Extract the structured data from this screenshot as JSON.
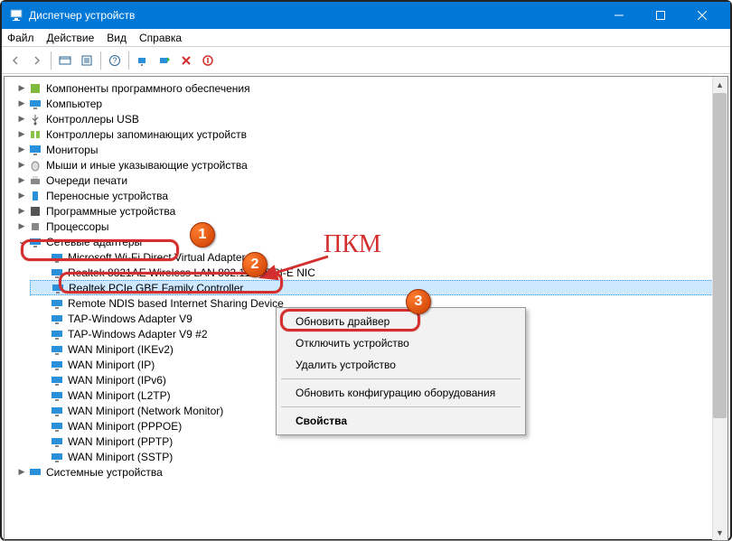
{
  "window": {
    "title": "Диспетчер устройств"
  },
  "menu": {
    "file": "Файл",
    "action": "Действие",
    "view": "Вид",
    "help": "Справка"
  },
  "tree": {
    "cat_software": "Компоненты программного обеспечения",
    "cat_computer": "Компьютер",
    "cat_usb": "Контроллеры USB",
    "cat_storage": "Контроллеры запоминающих устройств",
    "cat_monitors": "Мониторы",
    "cat_hid": "Мыши и иные указывающие устройства",
    "cat_print": "Очереди печати",
    "cat_portable": "Переносные устройства",
    "cat_prog": "Программные устройства",
    "cat_cpu": "Процессоры",
    "cat_net": "Сетевые адаптеры",
    "cat_sys": "Системные устройства",
    "net_items": [
      "Microsoft Wi-Fi Direct Virtual Adapter #2",
      "Realtek 8821AE Wireless LAN 802.11ac PCI-E NIC",
      "Realtek PCIe GBE Family Controller",
      "Remote NDIS based Internet Sharing Device",
      "TAP-Windows Adapter V9",
      "TAP-Windows Adapter V9 #2",
      "WAN Miniport (IKEv2)",
      "WAN Miniport (IP)",
      "WAN Miniport (IPv6)",
      "WAN Miniport (L2TP)",
      "WAN Miniport (Network Monitor)",
      "WAN Miniport (PPPOE)",
      "WAN Miniport (PPTP)",
      "WAN Miniport (SSTP)"
    ]
  },
  "context": {
    "update": "Обновить драйвер",
    "disable": "Отключить устройство",
    "uninstall": "Удалить устройство",
    "scan": "Обновить конфигурацию оборудования",
    "props": "Свойства"
  },
  "annotation": {
    "pkm": "ПКМ",
    "b1": "1",
    "b2": "2",
    "b3": "3"
  }
}
